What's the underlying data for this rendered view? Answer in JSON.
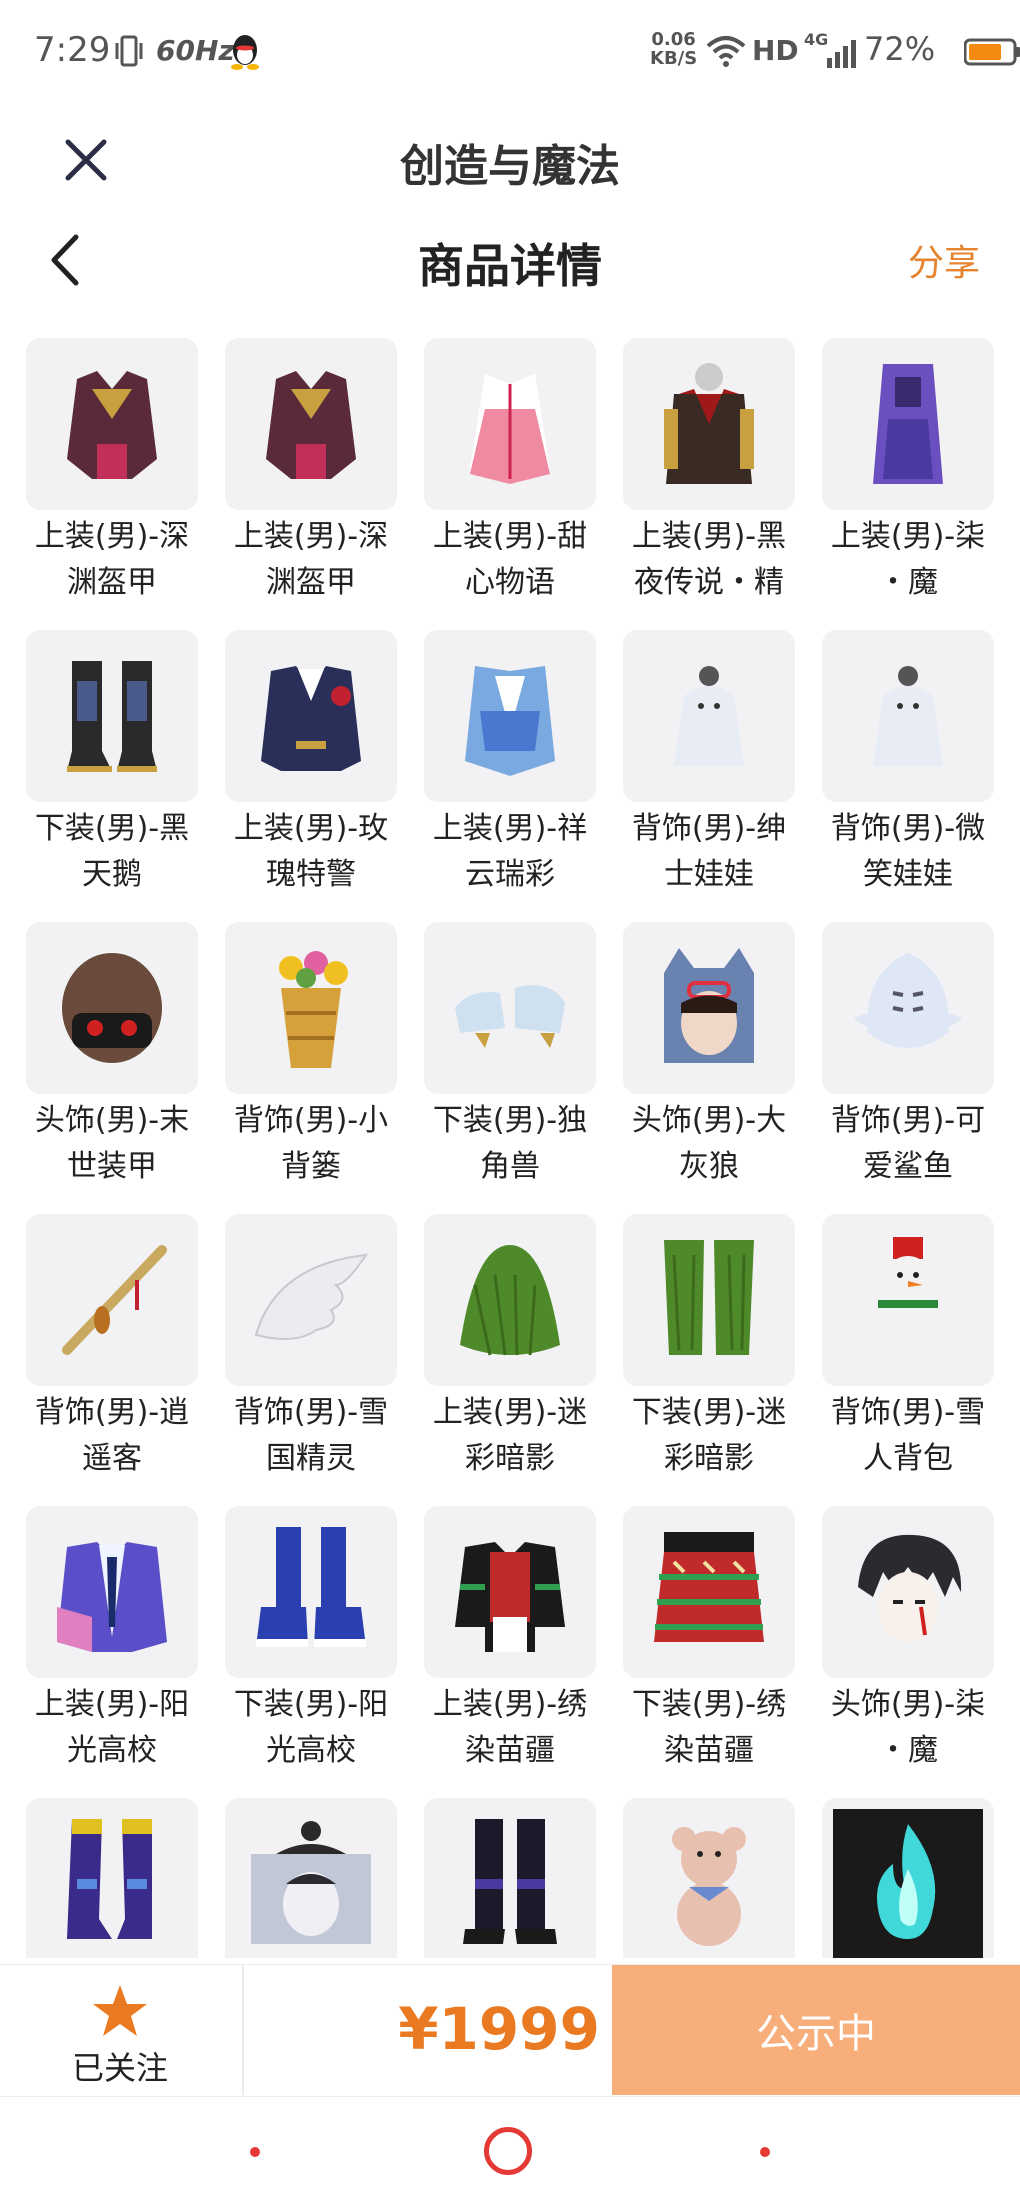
{
  "status_bar": {
    "time": "7:29",
    "refresh": "60Hz",
    "net_speed_value": "0.06",
    "net_speed_unit": "KB/S",
    "hd": "HD",
    "network": "4G",
    "battery": "72%"
  },
  "app_bar": {
    "title": "创造与魔法",
    "close_icon": "close-icon"
  },
  "page_header": {
    "title": "商品详情",
    "share_label": "分享",
    "back_icon": "chevron-left-icon"
  },
  "items": [
    {
      "line1": "上装(男)-深",
      "line2": "渊盔甲",
      "icon": "dark-armor",
      "color": "#5a2a3a"
    },
    {
      "line1": "上装(男)-深",
      "line2": "渊盔甲",
      "icon": "dark-armor",
      "color": "#5a2a3a"
    },
    {
      "line1": "上装(男)-甜",
      "line2": "心物语",
      "icon": "pink-robe",
      "color": "#f08aa0"
    },
    {
      "line1": "上装(男)-黑",
      "line2": "夜传说・精",
      "icon": "black-coat",
      "color": "#3a2a24"
    },
    {
      "line1": "上装(男)-柒",
      "line2": "・魔",
      "icon": "purple-hood",
      "color": "#6a4fc0"
    },
    {
      "line1": "下装(男)-黑",
      "line2": "天鹅",
      "icon": "black-boots",
      "color": "#2a2a2a"
    },
    {
      "line1": "上装(男)-玫",
      "line2": "瑰特警",
      "icon": "uniform",
      "color": "#2a2f5a"
    },
    {
      "line1": "上装(男)-祥",
      "line2": "云瑞彩",
      "icon": "blue-robe",
      "color": "#7aa8e0"
    },
    {
      "line1": "背饰(男)-绅",
      "line2": "士娃娃",
      "icon": "ghost-doll",
      "color": "#e8ecf5"
    },
    {
      "line1": "背饰(男)-微",
      "line2": "笑娃娃",
      "icon": "ghost-doll",
      "color": "#e8ecf5"
    },
    {
      "line1": "头饰(男)-末",
      "line2": "世装甲",
      "icon": "helmet",
      "color": "#6a4a3a"
    },
    {
      "line1": "背饰(男)-小",
      "line2": "背篓",
      "icon": "flower-basket",
      "color": "#d6a13a"
    },
    {
      "line1": "下装(男)-独",
      "line2": "角兽",
      "icon": "white-shoes",
      "color": "#cfe0f0"
    },
    {
      "line1": "头饰(男)-大",
      "line2": "灰狼",
      "icon": "wolf-hood",
      "color": "#6a82b0"
    },
    {
      "line1": "背饰(男)-可",
      "line2": "爱鲨鱼",
      "icon": "shark",
      "color": "#dfe6f5"
    },
    {
      "line1": "背饰(男)-逍",
      "line2": "遥客",
      "icon": "flute",
      "color": "#c9a860"
    },
    {
      "line1": "背饰(男)-雪",
      "line2": "国精灵",
      "icon": "wing",
      "color": "#ececf0"
    },
    {
      "line1": "上装(男)-迷",
      "line2": "彩暗影",
      "icon": "ghillie-top",
      "color": "#4f8a2a"
    },
    {
      "line1": "下装(男)-迷",
      "line2": "彩暗影",
      "icon": "ghillie-pants",
      "color": "#4f8a2a"
    },
    {
      "line1": "背饰(男)-雪",
      "line2": "人背包",
      "icon": "snowman",
      "color": "#f2f2f2"
    },
    {
      "line1": "上装(男)-阳",
      "line2": "光高校",
      "icon": "school-jacket",
      "color": "#5a4fc8"
    },
    {
      "line1": "下装(男)-阳",
      "line2": "光高校",
      "icon": "sneakers",
      "color": "#2a3fb0"
    },
    {
      "line1": "上装(男)-绣",
      "line2": "染苗疆",
      "icon": "ethnic-top",
      "color": "#c02a2a"
    },
    {
      "line1": "下装(男)-绣",
      "line2": "染苗疆",
      "icon": "ethnic-skirt",
      "color": "#c02a2a"
    },
    {
      "line1": "头饰(男)-柒",
      "line2": "・魔",
      "icon": "dark-hair",
      "color": "#2a2a30"
    },
    {
      "line1": "",
      "line2": "",
      "icon": "purple-boots",
      "color": "#3a2a8a"
    },
    {
      "line1": "",
      "line2": "",
      "icon": "veil-hat",
      "color": "#b8c0d0"
    },
    {
      "line1": "",
      "line2": "",
      "icon": "dark-legs",
      "color": "#1a1a2a"
    },
    {
      "line1": "",
      "line2": "",
      "icon": "teddy-bear",
      "color": "#e8c0b0"
    },
    {
      "line1": "",
      "line2": "",
      "icon": "cyan-flame",
      "color": "#40d8d8"
    }
  ],
  "action_bar": {
    "follow_label": "已关注",
    "price": "¥1999",
    "status_button": "公示中",
    "accent": "#ea7a22",
    "button_color": "#f7ae7a"
  },
  "nav": {
    "home_icon": "home-circle-icon"
  }
}
